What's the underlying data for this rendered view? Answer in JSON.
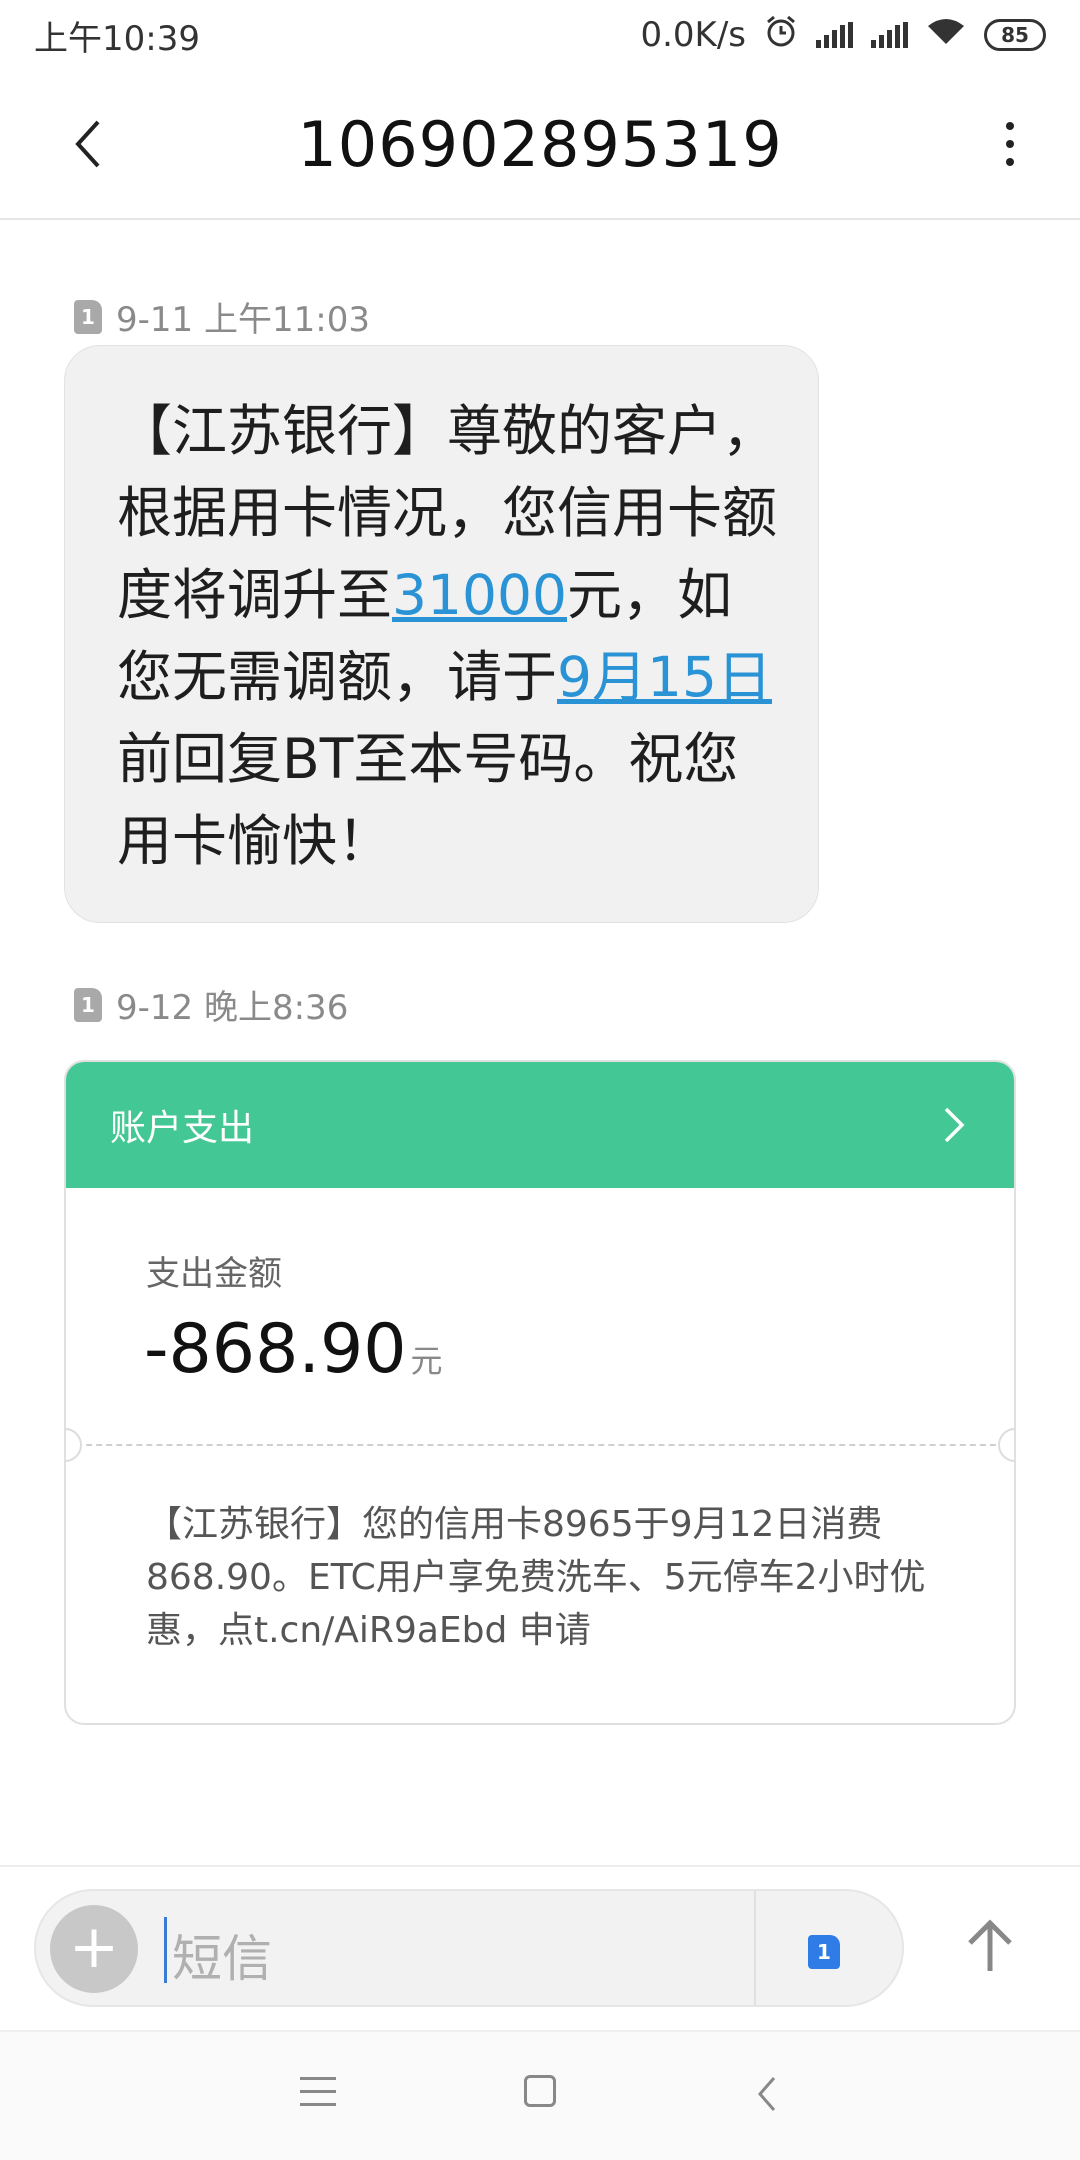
{
  "status_bar": {
    "time": "上午10:39",
    "network_speed": "0.0K/s",
    "battery": "85"
  },
  "header": {
    "title": "106902895319"
  },
  "messages": [
    {
      "meta": "9-11 上午11:03",
      "sim": "1",
      "text_parts": {
        "p1": "【江苏银行】尊敬的客户，根据用卡情况，您信用卡额度将调升至",
        "link_amount": "31000",
        "p2": "元，如您无需调额，请于",
        "link_date": "9月15日",
        "p3": "前回复BT至本号码。祝您用卡愉快！"
      }
    },
    {
      "meta": "9-12 晚上8:36",
      "sim": "1",
      "card": {
        "header": "账户支出",
        "amount_label": "支出金额",
        "amount": "-868.90",
        "amount_unit": "元",
        "text": "【江苏银行】您的信用卡8965于9月12日消费868.90。ETC用户享免费洗车、5元停车2小时优惠，点t.cn/AiR9aEbd 申请"
      }
    }
  ],
  "input": {
    "placeholder": "短信",
    "sim": "1"
  },
  "colors": {
    "card_header": "#43c794",
    "link": "#2a93d5",
    "sim_button": "#2f7ce6"
  }
}
